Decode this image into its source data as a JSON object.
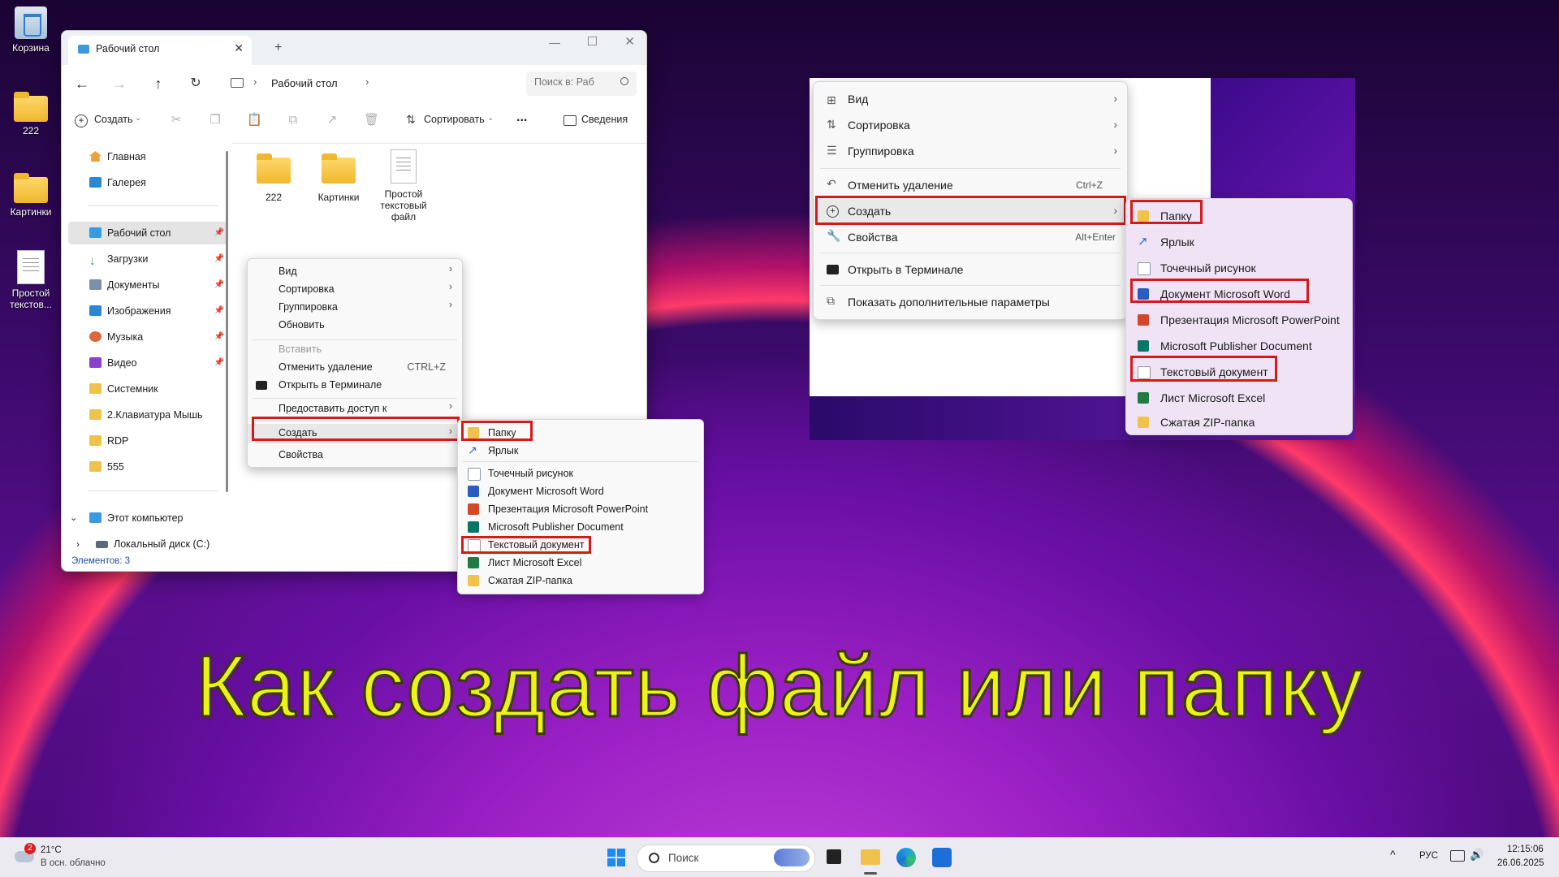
{
  "desktop": {
    "icons": [
      {
        "label": "Корзина"
      },
      {
        "label": "222"
      },
      {
        "label": "Картинки"
      },
      {
        "label": "Простой текстов..."
      }
    ]
  },
  "explorer": {
    "tab_title": "Рабочий стол",
    "breadcrumb": "Рабочий стол",
    "search_placeholder": "Поиск в: Раб",
    "cmd": {
      "create": "Создать",
      "sort": "Сортировать",
      "more": "...",
      "details": "Сведения"
    },
    "sidebar": [
      {
        "label": "Главная",
        "pinned": false
      },
      {
        "label": "Галерея",
        "pinned": false
      },
      {
        "label": "Рабочий стол",
        "pinned": true
      },
      {
        "label": "Загрузки",
        "pinned": true
      },
      {
        "label": "Документы",
        "pinned": true
      },
      {
        "label": "Изображения",
        "pinned": true
      },
      {
        "label": "Музыка",
        "pinned": true
      },
      {
        "label": "Видео",
        "pinned": true
      },
      {
        "label": "Системник",
        "pinned": false
      },
      {
        "label": "2.Клавиатура Мышь",
        "pinned": false
      },
      {
        "label": "RDP",
        "pinned": false
      },
      {
        "label": "555",
        "pinned": false
      },
      {
        "label": "Этот компьютер",
        "pinned": false
      },
      {
        "label": "Локальный диск (C:)",
        "pinned": false
      }
    ],
    "files": [
      {
        "label": "222"
      },
      {
        "label": "Картинки"
      },
      {
        "label": "Простой текстовый файл"
      }
    ],
    "status": "Элементов: 3"
  },
  "context_menu_small": {
    "items": [
      "Вид",
      "Сортировка",
      "Группировка",
      "Обновить",
      "Вставить",
      "Отменить удаление",
      "Открыть в Терминале",
      "Предоставить доступ к",
      "Создать",
      "Свойства"
    ],
    "undo_shortcut": "CTRL+Z"
  },
  "submenu_small": {
    "items": [
      "Папку",
      "Ярлык",
      "Точечный рисунок",
      "Документ Microsoft Word",
      "Презентация Microsoft PowerPoint",
      "Microsoft Publisher Document",
      "Текстовый документ",
      "Лист Microsoft Excel",
      "Сжатая ZIP-папка"
    ]
  },
  "context_menu_big": {
    "items": [
      "Вид",
      "Сортировка",
      "Группировка",
      "Отменить удаление",
      "Создать",
      "Свойства",
      "Открыть в Терминале",
      "Показать дополнительные параметры"
    ],
    "undo_shortcut": "Ctrl+Z",
    "properties_shortcut": "Alt+Enter"
  },
  "submenu_big": {
    "items": [
      "Папку",
      "Ярлык",
      "Точечный рисунок",
      "Документ Microsoft Word",
      "Презентация Microsoft PowerPoint",
      "Microsoft Publisher Document",
      "Текстовый документ",
      "Лист Microsoft Excel",
      "Сжатая ZIP-папка"
    ]
  },
  "headline": "Как создать файл или папку",
  "taskbar": {
    "weather_badge": "2",
    "temp": "21°C",
    "weather": "В осн. облачно",
    "search_placeholder": "Поиск",
    "lang": "РУС",
    "time": "12:15:06",
    "date": "26.06.2025"
  },
  "colors": {
    "highlight": "#d61a1a",
    "headline": "#ecf21a"
  }
}
